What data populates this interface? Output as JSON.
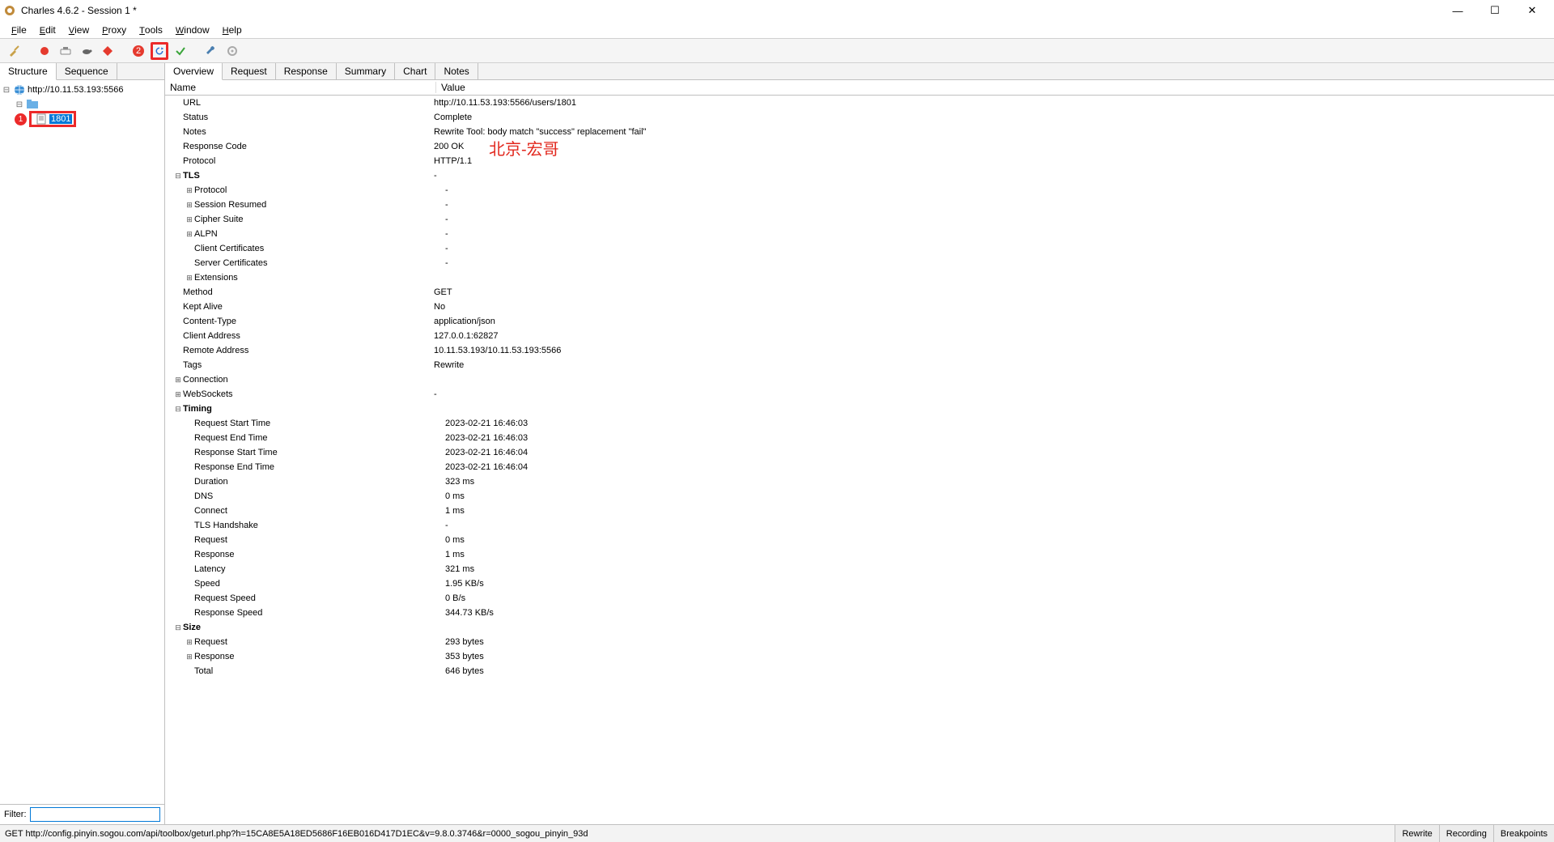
{
  "window": {
    "title": "Charles 4.6.2 - Session 1 *"
  },
  "menu": {
    "file": "File",
    "edit": "Edit",
    "view": "View",
    "proxy": "Proxy",
    "tools": "Tools",
    "window": "Window",
    "help": "Help"
  },
  "left_tabs": {
    "structure": "Structure",
    "sequence": "Sequence"
  },
  "tree": {
    "host": "http://10.11.53.193:5566",
    "item": "1801"
  },
  "filter_label": "Filter:",
  "annotation": "北京-宏哥",
  "badge1": "1",
  "right_tabs": {
    "overview": "Overview",
    "request": "Request",
    "response": "Response",
    "summary": "Summary",
    "chart": "Chart",
    "notes": "Notes"
  },
  "headers": {
    "name": "Name",
    "value": "Value"
  },
  "overview": {
    "url_k": "URL",
    "url_v": "http://10.11.53.193:5566/users/1801",
    "status_k": "Status",
    "status_v": "Complete",
    "notes_k": "Notes",
    "notes_v": "Rewrite Tool: body match \"success\" replacement \"fail\"",
    "rc_k": "Response Code",
    "rc_v": "200 OK",
    "proto_k": "Protocol",
    "proto_v": "HTTP/1.1",
    "tls_k": "TLS",
    "tls_v": "-",
    "tls_proto_k": "Protocol",
    "tls_proto_v": "-",
    "tls_sr_k": "Session Resumed",
    "tls_sr_v": "-",
    "tls_cs_k": "Cipher Suite",
    "tls_cs_v": "-",
    "tls_alpn_k": "ALPN",
    "tls_alpn_v": "-",
    "tls_cc_k": "Client Certificates",
    "tls_cc_v": "-",
    "tls_sc_k": "Server Certificates",
    "tls_sc_v": "-",
    "tls_ext_k": "Extensions",
    "method_k": "Method",
    "method_v": "GET",
    "ka_k": "Kept Alive",
    "ka_v": "No",
    "ct_k": "Content-Type",
    "ct_v": "application/json",
    "ca_k": "Client Address",
    "ca_v": "127.0.0.1:62827",
    "ra_k": "Remote Address",
    "ra_v": "10.11.53.193/10.11.53.193:5566",
    "tags_k": "Tags",
    "tags_v": "Rewrite",
    "conn_k": "Connection",
    "ws_k": "WebSockets",
    "ws_v": "-",
    "timing_k": "Timing",
    "rqst_k": "Request Start Time",
    "rqst_v": "2023-02-21 16:46:03",
    "rqet_k": "Request End Time",
    "rqet_v": "2023-02-21 16:46:03",
    "rsst_k": "Response Start Time",
    "rsst_v": "2023-02-21 16:46:04",
    "rset_k": "Response End Time",
    "rset_v": "2023-02-21 16:46:04",
    "dur_k": "Duration",
    "dur_v": "323 ms",
    "dns_k": "DNS",
    "dns_v": "0 ms",
    "connt_k": "Connect",
    "connt_v": "1 ms",
    "tlsh_k": "TLS Handshake",
    "tlsh_v": "-",
    "reqt_k": "Request",
    "reqt_v": "0 ms",
    "respt_k": "Response",
    "respt_v": "1 ms",
    "lat_k": "Latency",
    "lat_v": "321 ms",
    "spd_k": "Speed",
    "spd_v": "1.95 KB/s",
    "rqspd_k": "Request Speed",
    "rqspd_v": "0 B/s",
    "rsspd_k": "Response Speed",
    "rsspd_v": "344.73 KB/s",
    "size_k": "Size",
    "sreq_k": "Request",
    "sreq_v": "293 bytes",
    "sresp_k": "Response",
    "sresp_v": "353 bytes",
    "stot_k": "Total",
    "stot_v": "646 bytes"
  },
  "statusbar": {
    "left": "GET http://config.pinyin.sogou.com/api/toolbox/geturl.php?h=15CA8E5A18ED5686F16EB016D417D1EC&v=9.8.0.3746&r=0000_sogou_pinyin_93d",
    "rewrite": "Rewrite",
    "recording": "Recording",
    "breakpoints": "Breakpoints"
  }
}
